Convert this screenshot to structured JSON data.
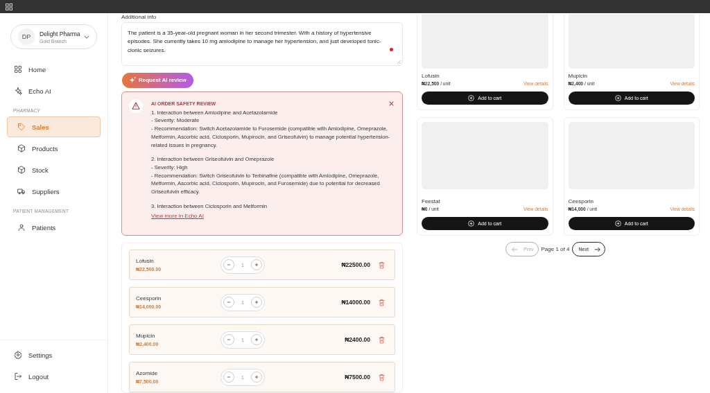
{
  "sidebar": {
    "org": {
      "initials": "DP",
      "name": "Delight Pharma",
      "branch": "Gold Branch"
    },
    "nav": [
      {
        "label": "Home",
        "selected": false
      },
      {
        "label": "Echo AI",
        "selected": false
      },
      {
        "kind": "section",
        "label": "PHARMACY"
      },
      {
        "label": "Sales",
        "selected": true
      },
      {
        "label": "Products",
        "selected": false
      },
      {
        "label": "Stock",
        "selected": false
      },
      {
        "label": "Suppliers",
        "selected": false
      },
      {
        "kind": "section",
        "label": "PATIENT MANAGEMENT"
      },
      {
        "label": "Patients",
        "selected": false
      }
    ],
    "footer": [
      {
        "label": "Settings"
      },
      {
        "label": "Logout"
      }
    ]
  },
  "additional_info": {
    "label": "Additional info",
    "value": "The patient is a 35-year-old pregnant woman in her second trimester. With a history of hypertensive episodes. She currently takes 10 mg amlodipine to manage her hypertension, and just developed tonic-clonic seizures."
  },
  "review_button": "Request AI review",
  "review": {
    "title": "AI ORDER SAFETY REVIEW",
    "paragraphs": [
      [
        "1. Interaction between Amlodipine and Acetazolamide",
        "- Severity: Moderate",
        "- Recommendation: Switch Acetazolamide to Furosemide (compatible with Amlodipine, Omeprazole, Metformin, Ascorbic acid, Ciclosporin, Mupirocin, and Griseofulvin) to manage potential hypertension-related issues in pregnancy."
      ],
      [
        "2. Interaction between Griseofulvin and Omeprazole",
        "- Severity: High",
        "- Recommendation: Switch Griseofulvin to Terbinafine (compatible with Amlodipine, Omeprazole, Metformin, Ascorbic acid, Ciclosporin, Mupirocin, and Furosemide) due to potential for decreased Griseofulvin efficacy."
      ],
      [
        "3. Interaction between Ciclosporin and Metformin"
      ]
    ],
    "link": "View more in Echo AI"
  },
  "cart": [
    {
      "name": "Lofusin",
      "unit_price": "₦22,500.00",
      "quantity": "1",
      "total": "₦22500.00"
    },
    {
      "name": "Ceesporin",
      "unit_price": "₦14,000.00",
      "quantity": "1",
      "total": "₦14000.00"
    },
    {
      "name": "Mupicin",
      "unit_price": "₦2,400.00",
      "quantity": "1",
      "total": "₦2400.00"
    },
    {
      "name": "Azomide",
      "unit_price": "₦7,500.00",
      "quantity": "1",
      "total": "₦7500.00"
    }
  ],
  "products": [
    {
      "name": "Lofusin",
      "price": "₦22,500",
      "unit": " / unit",
      "details": "View details",
      "button": "Add to cart"
    },
    {
      "name": "Mupicin",
      "price": "₦2,400",
      "unit": " / unit",
      "details": "View details",
      "button": "Add to cart"
    },
    {
      "name": "Feestat",
      "price": "₦0",
      "unit": " / unit",
      "details": "View details",
      "button": "Add to cart"
    },
    {
      "name": "Ceesporin",
      "price": "₦14,000",
      "unit": " / unit",
      "details": "View details",
      "button": "Add to cart"
    }
  ],
  "pagination": {
    "prev": {
      "label": "Prev",
      "disabled": true
    },
    "text": "Page 1 of 4",
    "next": {
      "label": "Next",
      "disabled": false
    }
  }
}
